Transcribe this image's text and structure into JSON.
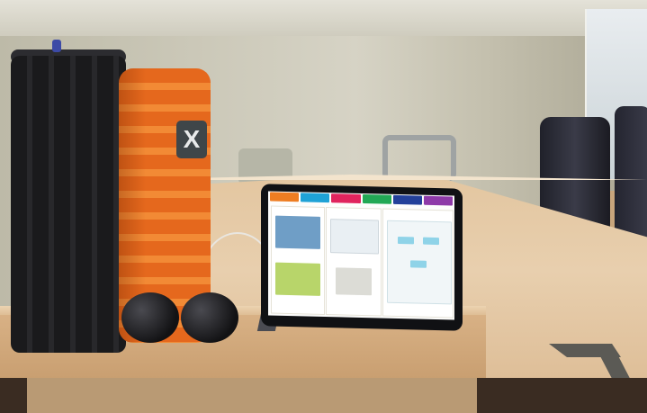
{
  "scene": {
    "subject": "",
    "colors": {
      "wall": "#cbc8b8",
      "desk": "#e3c6a0",
      "roller_orange": "#e5681d",
      "roller_black": "#1a1a1c",
      "tablet_bezel": "#101114"
    }
  },
  "roller_brand": {
    "mark": "X"
  },
  "tablet_screen": {
    "tabs": [
      {
        "label": "",
        "color": "#ee7d22"
      },
      {
        "label": "",
        "color": "#1fa2d6"
      },
      {
        "label": "",
        "color": "#e0245e"
      },
      {
        "label": "",
        "color": "#22a855"
      },
      {
        "label": "",
        "color": "#23409a"
      },
      {
        "label": "",
        "color": "#8e3aa8"
      }
    ],
    "panels": [
      {
        "title": "",
        "caption": ""
      },
      {
        "title": "",
        "caption": ""
      },
      {
        "title": "",
        "caption": ""
      }
    ]
  }
}
